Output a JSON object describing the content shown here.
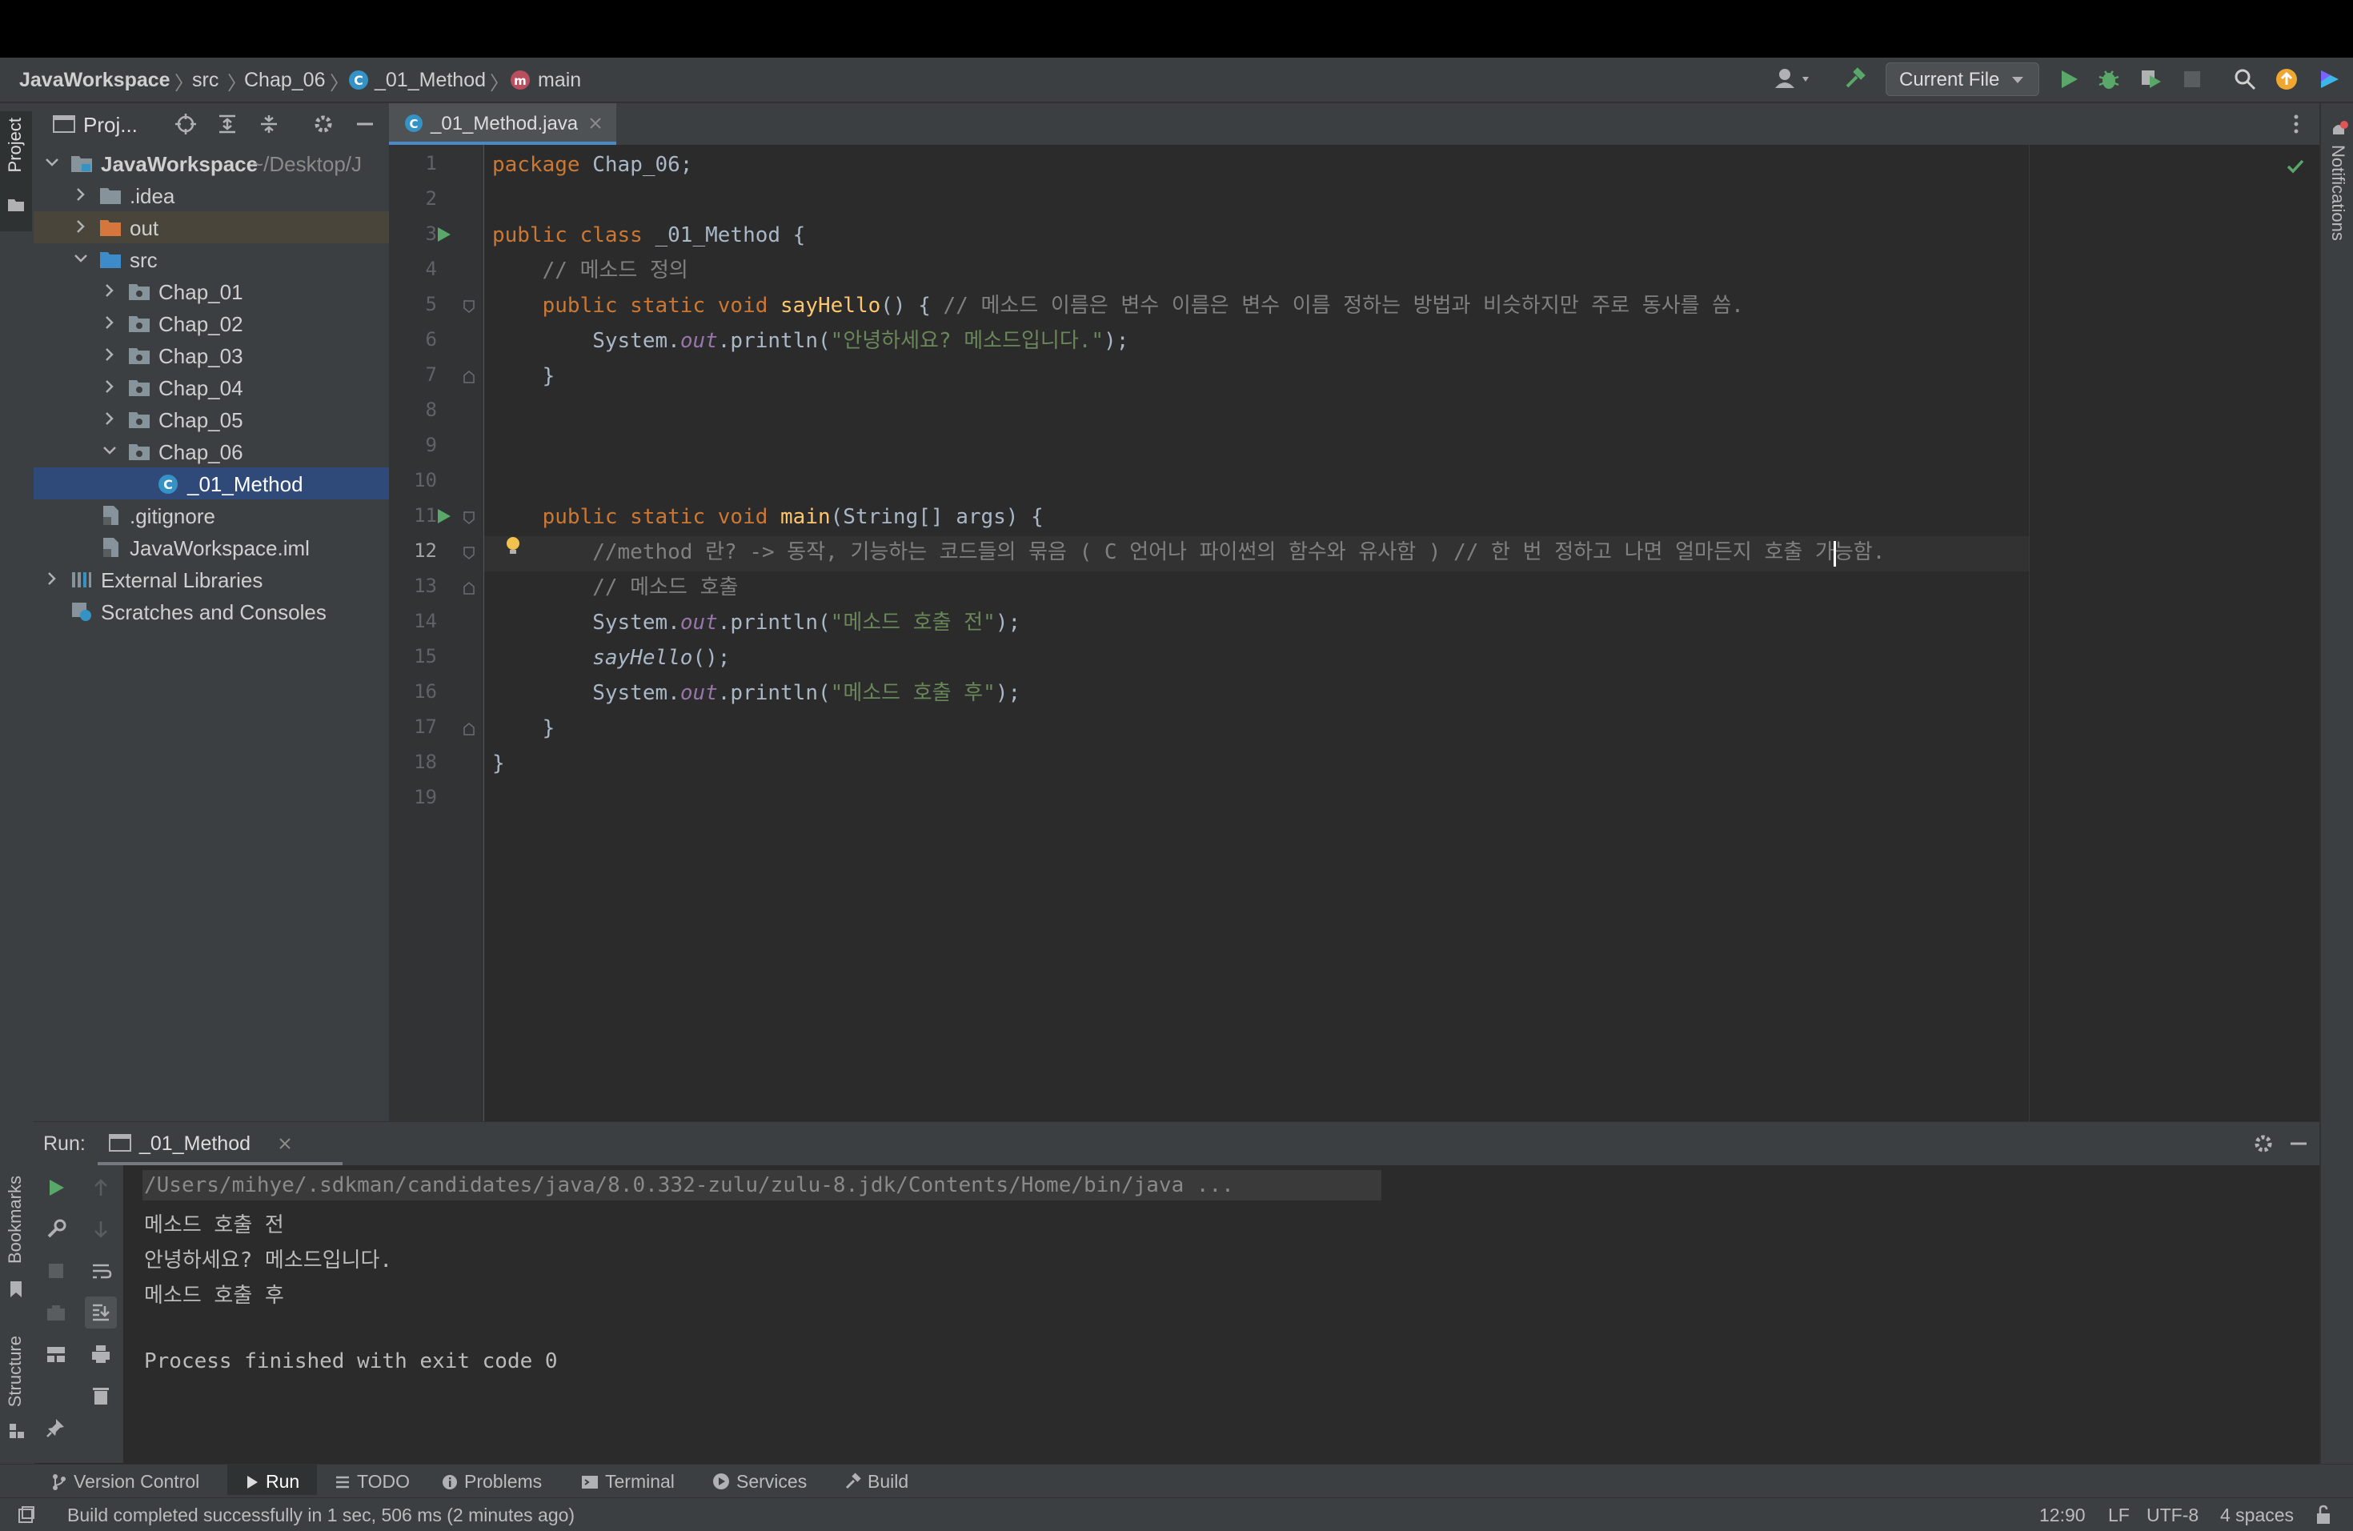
{
  "breadcrumb": [
    "JavaWorkspace",
    "src",
    "Chap_06",
    "_01_Method",
    "main"
  ],
  "toolbar": {
    "run_config": "Current File"
  },
  "left_strip": {
    "project_label": "Project",
    "bookmarks_label": "Bookmarks",
    "structure_label": "Structure"
  },
  "right_strip": {
    "notifications_label": "Notifications"
  },
  "project_panel": {
    "title": "Proj...",
    "tree": [
      {
        "label": "JavaWorkspace",
        "hint": "~/Desktop/J",
        "icon": "module-folder-icon"
      },
      {
        "label": ".idea",
        "icon": "folder-icon"
      },
      {
        "label": "out",
        "icon": "excluded-folder-icon"
      },
      {
        "label": "src",
        "icon": "source-folder-icon"
      },
      {
        "label": "Chap_01",
        "icon": "package-icon"
      },
      {
        "label": "Chap_02",
        "icon": "package-icon"
      },
      {
        "label": "Chap_03",
        "icon": "package-icon"
      },
      {
        "label": "Chap_04",
        "icon": "package-icon"
      },
      {
        "label": "Chap_05",
        "icon": "package-icon"
      },
      {
        "label": "Chap_06",
        "icon": "package-icon"
      },
      {
        "label": "_01_Method",
        "icon": "java-class-icon"
      },
      {
        "label": ".gitignore",
        "icon": "file-icon"
      },
      {
        "label": "JavaWorkspace.iml",
        "icon": "iml-file-icon"
      },
      {
        "label": "External Libraries",
        "icon": "libraries-icon"
      },
      {
        "label": "Scratches and Consoles",
        "icon": "scratches-icon"
      }
    ]
  },
  "editor": {
    "tab_label": "_01_Method.java",
    "line_numbers": [
      "1",
      "2",
      "3",
      "4",
      "5",
      "6",
      "7",
      "8",
      "9",
      "10",
      "11",
      "12",
      "13",
      "14",
      "15",
      "16",
      "17",
      "18",
      "19"
    ],
    "code": {
      "l1_kw": "package",
      "l1_rest": " Chap_06;",
      "l3_kw": "public class",
      "l3_rest": " _01_Method {",
      "l4_cm": "    // 메소드 정의",
      "l5_kw": "    public static void ",
      "l5_fn": "sayHello",
      "l5_rest": "() { ",
      "l5_cm": "// 메소드 이름은 변수 이름은 변수 이름 정하는 방법과 비슷하지만 주로 동사를 씀.",
      "l6_a": "        System.",
      "l6_out": "out",
      "l6_b": ".println(",
      "l6_str": "\"안녕하세요? 메소드입니다.\"",
      "l6_c": ");",
      "l7": "    }",
      "l11_kw": "    public static void ",
      "l11_fn": "main",
      "l11_rest": "(String[] args) {",
      "l12_cm": "        //method 란? -> 동작, 기능하는 코드들의 묶음 ( C 언어나 파이썬의 함수와 유사함 ) // 한 번 정하고 나면 얼마든지 호출 가능함.",
      "l13_cm": "        // 메소드 호출",
      "l14_a": "        System.",
      "l14_out": "out",
      "l14_b": ".println(",
      "l14_str": "\"메소드 호출 전\"",
      "l14_c": ");",
      "l15_a": "        ",
      "l15_it": "sayHello",
      "l15_b": "();",
      "l16_a": "        System.",
      "l16_out": "out",
      "l16_b": ".println(",
      "l16_str": "\"메소드 호출 후\"",
      "l16_c": ");",
      "l17": "    }",
      "l18": "}"
    }
  },
  "run_panel": {
    "label": "Run:",
    "tab_label": "_01_Method",
    "console": [
      "/Users/mihye/.sdkman/candidates/java/8.0.332-zulu/zulu-8.jdk/Contents/Home/bin/java ...",
      "메소드 호출 전",
      "안녕하세요? 메소드입니다.",
      "메소드 호출 후",
      "",
      "Process finished with exit code 0"
    ]
  },
  "bottom_tabs": [
    "Version Control",
    "Run",
    "TODO",
    "Problems",
    "Terminal",
    "Services",
    "Build"
  ],
  "status_bar": {
    "message": "Build completed successfully in 1 sec, 506 ms (2 minutes ago)",
    "position": "12:90",
    "line_ending": "LF",
    "encoding": "UTF-8",
    "indent": "4 spaces"
  },
  "colors": {
    "accent": "#4a88c7",
    "run_green": "#59a869",
    "keyword": "#cc7832",
    "function": "#ffc66d",
    "string": "#6a8759",
    "comment": "#808080"
  }
}
